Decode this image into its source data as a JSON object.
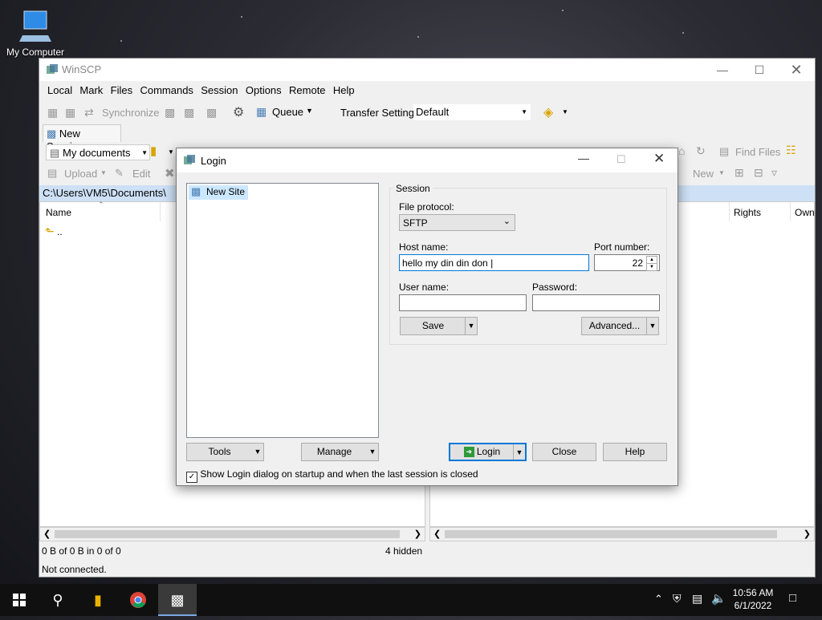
{
  "desktop": {
    "icon_label": "My Computer"
  },
  "main_window": {
    "title": "WinSCP",
    "menu": [
      "Local",
      "Mark",
      "Files",
      "Commands",
      "Session",
      "Options",
      "Remote",
      "Help"
    ],
    "toolbar": {
      "synchronize": "Synchronize",
      "queue": "Queue",
      "transfer_settings_label": "Transfer Settings",
      "transfer_settings_value": "Default"
    },
    "tab": "New Session",
    "local": {
      "dir_combo": "My documents",
      "upload": "Upload",
      "edit": "Edit",
      "path": "C:\\Users\\VM5\\Documents\\",
      "col_name": "Name",
      "rows": [
        ".."
      ]
    },
    "remote": {
      "find_files": "Find Files",
      "new": "New",
      "col_rights": "Rights",
      "col_owner": "Own"
    },
    "status": {
      "selection": "0 B of 0 B in 0 of 0",
      "hidden": "4 hidden",
      "connection": "Not connected."
    }
  },
  "login_dialog": {
    "title": "Login",
    "site_tree": [
      "New Site"
    ],
    "session_group": "Session",
    "file_protocol_label": "File protocol:",
    "file_protocol_value": "SFTP",
    "host_label": "Host name:",
    "host_value": "hello my din din don |",
    "port_label": "Port number:",
    "port_value": "22",
    "user_label": "User name:",
    "user_value": "",
    "password_label": "Password:",
    "password_value": "",
    "save": "Save",
    "advanced": "Advanced...",
    "tools": "Tools",
    "manage": "Manage",
    "login": "Login",
    "close": "Close",
    "help": "Help",
    "show_dialog_label": "Show Login dialog on startup and when the last session is closed",
    "show_dialog_checked": true
  },
  "taskbar": {
    "time": "10:56 AM",
    "date": "6/1/2022",
    "icons": [
      "start-icon",
      "search-icon",
      "file-explorer-icon",
      "chrome-icon",
      "winscp-icon"
    ]
  },
  "colors": {
    "accent": "#0078d7",
    "selection": "#cce8ff",
    "pathbar": "#cde0f5",
    "taskbar": "#101010"
  }
}
